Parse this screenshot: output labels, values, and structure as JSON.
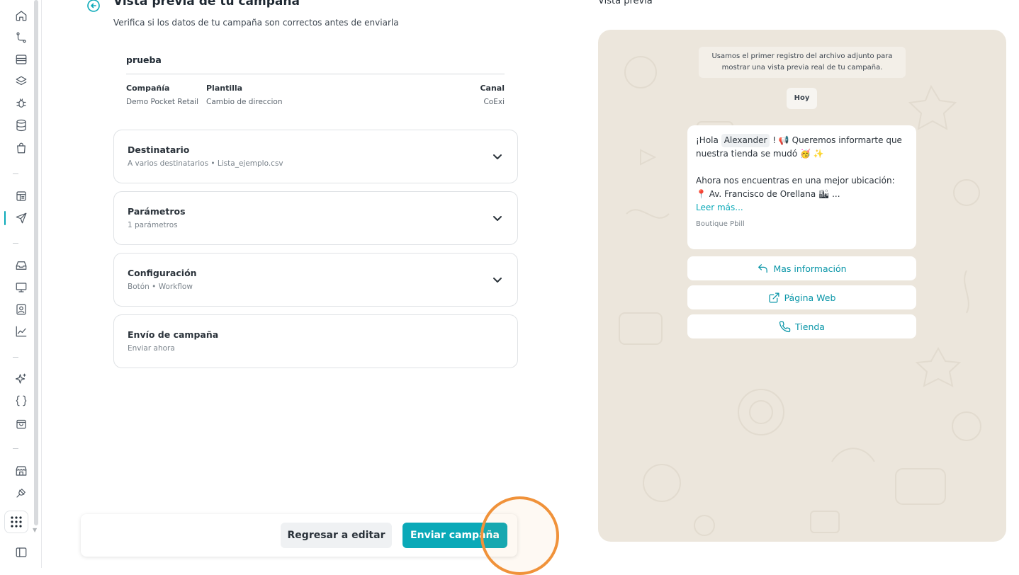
{
  "sidebar": {
    "icons": [
      "home-icon",
      "flow-icon",
      "archive-icon",
      "layers-icon",
      "bug-icon",
      "database-icon",
      "bag-icon",
      "template-icon",
      "send-icon",
      "inbox-icon",
      "monitor-icon",
      "contact-icon",
      "chart-icon",
      "sparkles-icon",
      "braces-icon",
      "shopping-bag-icon",
      "store-icon",
      "plug-icon",
      "apps-icon",
      "sidebar-toggle-icon"
    ],
    "active": "send-icon",
    "accent": "#0aa9b8"
  },
  "header": {
    "title": "Vista previa de tu campaña",
    "subtitle": "Verifica si los datos de tu campaña son correctos antes de enviarla"
  },
  "campaign": {
    "name": "prueba",
    "company_label": "Compañía",
    "company_value": "Demo Pocket Retail",
    "template_label": "Plantilla",
    "template_value": "Cambio de direccion",
    "channel_label": "Canal",
    "channel_value": "CoExi"
  },
  "sections": [
    {
      "title": "Destinatario",
      "subtitle": "A varios destinatarios • Lista_ejemplo.csv"
    },
    {
      "title": "Parámetros",
      "subtitle": "1 parámetros"
    },
    {
      "title": "Configuración",
      "subtitle": "Botón • Workflow"
    },
    {
      "title": "Envío de campaña",
      "subtitle": "Enviar ahora"
    }
  ],
  "footer": {
    "back_label": "Regresar a editar",
    "send_label": "Enviar campaña"
  },
  "preview": {
    "title": "Vista previa",
    "notice_line1": "Usamos el primer registro del archivo adjunto para",
    "notice_line2": "mostrar una vista previa real de tu campaña.",
    "date": "Hoy",
    "msg_greeting": "¡Hola",
    "msg_name": "Alexander",
    "msg_after_name": "! 📢 Queremos informarte que",
    "msg_line2": "nuestra tienda se mudó 🥳 ✨",
    "msg_line3": "Ahora nos encuentras en una mejor ubicación:",
    "msg_line4": "📍 Av. Francisco de Orellana 🏙 ...",
    "read_more": "Leer más...",
    "sender": "Boutique Pbill",
    "buttons": [
      {
        "icon": "reply-icon",
        "label": "Mas información"
      },
      {
        "icon": "external-link-icon",
        "label": "Página Web"
      },
      {
        "icon": "phone-icon",
        "label": "Tienda"
      }
    ]
  }
}
